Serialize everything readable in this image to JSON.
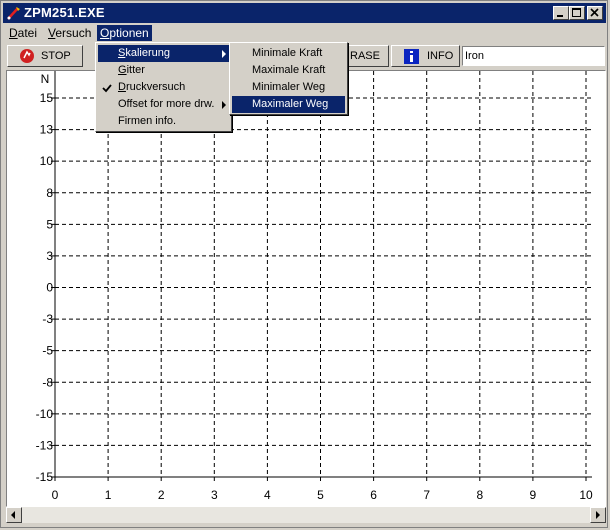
{
  "window": {
    "title": "ZPM251.EXE"
  },
  "menubar": {
    "items": [
      {
        "label": "Datei",
        "key": "D",
        "rest": "atei"
      },
      {
        "label": "Versuch",
        "key": "V",
        "rest": "ersuch"
      },
      {
        "label": "Optionen",
        "key": "O",
        "rest": "ptionen"
      }
    ]
  },
  "toolbar": {
    "stop_label": "STOP",
    "erase_label": "RASE",
    "info_label": "INFO",
    "material_value": "Iron"
  },
  "optionen_menu": {
    "items": [
      {
        "key": "S",
        "rest": "kalierung",
        "submenu": true,
        "active": true
      },
      {
        "key": "G",
        "rest": "itter",
        "submenu": false
      },
      {
        "key": "D",
        "rest": "ruckversuch",
        "submenu": false,
        "checked": true
      },
      {
        "key": "",
        "rest": "Offset for more drw.",
        "submenu": true
      },
      {
        "key": "",
        "rest": "Firmen info.",
        "submenu": false
      }
    ]
  },
  "skalierung_menu": {
    "items": [
      {
        "label": "Minimale Kraft"
      },
      {
        "label": "Maximale Kraft"
      },
      {
        "label": "Minimaler Weg"
      },
      {
        "label": "Maximaler Weg",
        "active": true
      }
    ]
  },
  "chart_data": {
    "type": "line",
    "ylabel": "N",
    "xlabel": "",
    "y_ticks": [
      "15",
      "13",
      "10",
      "8",
      "5",
      "3",
      "0",
      "-3",
      "-5",
      "-8",
      "-10",
      "-13",
      "-15"
    ],
    "x_ticks": [
      "0",
      "1",
      "2",
      "3",
      "4",
      "5",
      "6",
      "7",
      "8",
      "9",
      "10"
    ],
    "xlim": [
      0,
      10
    ],
    "ylim": [
      -15,
      15
    ],
    "grid": true,
    "series": []
  },
  "colors": {
    "titlebar": "#0a246a",
    "window": "#d4d0c8",
    "plot": "#ffffff",
    "grid": "#000000"
  }
}
